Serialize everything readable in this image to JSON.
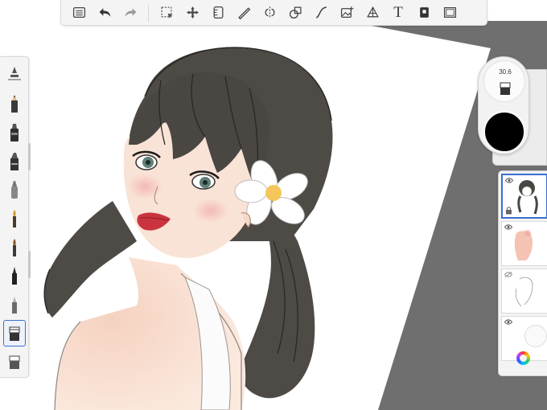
{
  "toolbar": {
    "items": [
      "list-icon",
      "undo-icon",
      "redo-icon",
      "selection-icon",
      "transform-icon",
      "ruler-icon",
      "stroke-icon",
      "symmetry-icon",
      "shape-icon",
      "curve-icon",
      "add-image-icon",
      "perspective-icon",
      "text-icon",
      "copic-icon",
      "frame-icon"
    ],
    "text_tool_label": "T"
  },
  "brush_puck": {
    "size_value": "30.6",
    "current_color": "#000000"
  },
  "brushes": [
    "brush-ballpoint-icon",
    "brush-pencil-icon",
    "brush-marker-icon",
    "brush-chisel-icon",
    "brush-airbrush-icon",
    "brush-paintbrush-icon",
    "brush-wet-icon",
    "brush-ink-icon",
    "brush-blender-icon",
    "brush-eraser-icon",
    "brush-eraser-alt-icon"
  ],
  "layers": [
    {
      "name": "layer-1",
      "visible": true,
      "active": true
    },
    {
      "name": "layer-2",
      "visible": true,
      "active": false
    },
    {
      "name": "layer-3",
      "visible": false,
      "active": false
    },
    {
      "name": "layer-4",
      "visible": true,
      "active": false
    }
  ],
  "colors": {
    "accent": "#3a6fcf",
    "toolbar_bg": "#f4f4f4",
    "workspace_bg": "#6f6f6f",
    "hair": "#4a4642",
    "skin": "#f6dccb",
    "lips": "#c9343f"
  }
}
